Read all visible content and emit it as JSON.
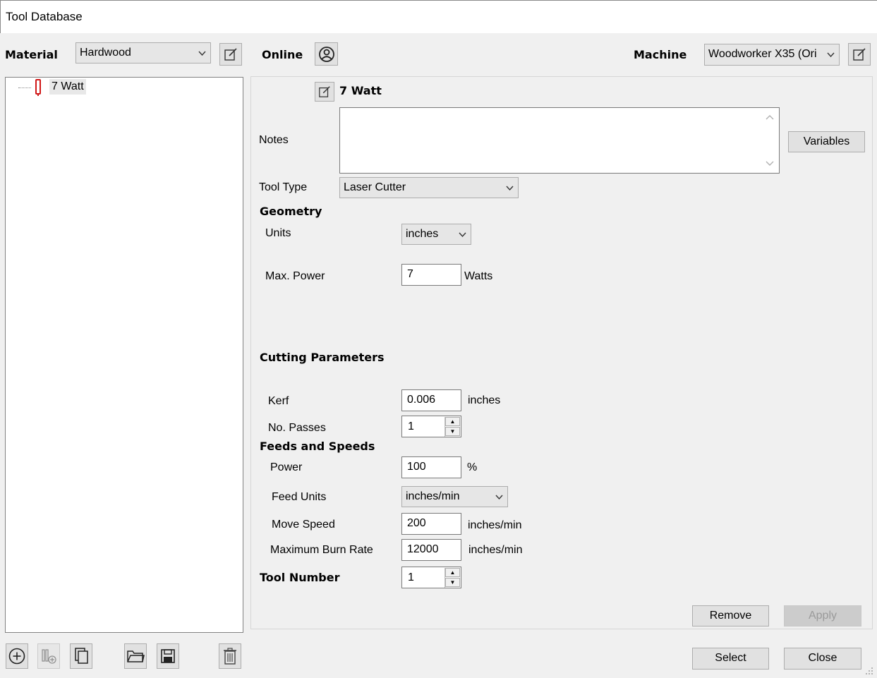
{
  "window": {
    "title": "Tool Database"
  },
  "header": {
    "material_label": "Material",
    "material_value": "Hardwood",
    "online_label": "Online",
    "machine_label": "Machine",
    "machine_value": "Woodworker X35 (Ori"
  },
  "tree": {
    "items": [
      {
        "label": "7 Watt",
        "icon": "laser-tool-icon"
      }
    ]
  },
  "tool": {
    "name": "7 Watt",
    "notes_label": "Notes",
    "notes_value": "",
    "variables_button": "Variables",
    "tool_type_label": "Tool Type",
    "tool_type_value": "Laser Cutter",
    "geometry_heading": "Geometry",
    "units_label": "Units",
    "units_value": "inches",
    "max_power_label": "Max. Power",
    "max_power_value": "7",
    "max_power_unit": "Watts",
    "cutting_heading": "Cutting Parameters",
    "kerf_label": "Kerf",
    "kerf_value": "0.006",
    "kerf_unit": "inches",
    "passes_label": "No. Passes",
    "passes_value": "1",
    "feeds_heading": "Feeds and Speeds",
    "power_label": "Power",
    "power_value": "100",
    "power_unit": "%",
    "feed_units_label": "Feed Units",
    "feed_units_value": "inches/min",
    "move_speed_label": "Move Speed",
    "move_speed_value": "200",
    "move_speed_unit": "inches/min",
    "burn_rate_label": "Maximum Burn Rate",
    "burn_rate_value": "12000",
    "burn_rate_unit": "inches/min",
    "tool_number_label": "Tool Number",
    "tool_number_value": "1",
    "remove_button": "Remove",
    "apply_button": "Apply"
  },
  "footer": {
    "select_button": "Select",
    "close_button": "Close"
  },
  "colors": {
    "laser_icon": "#d01818",
    "window_bg": "#f0f0f0",
    "disabled_text": "#9a9a9a"
  }
}
